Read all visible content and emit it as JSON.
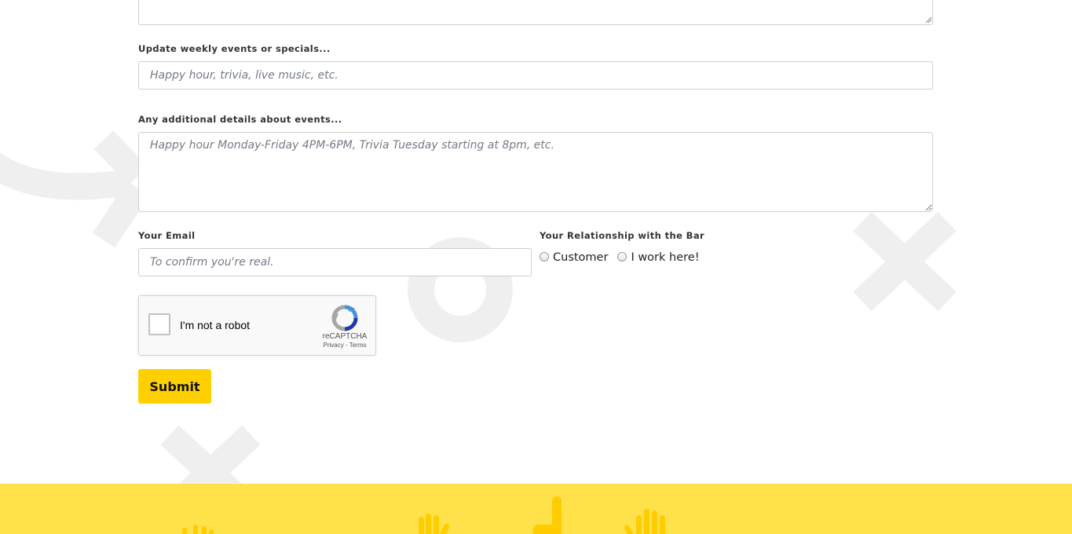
{
  "form": {
    "weekly_events": {
      "label": "Update weekly events or specials...",
      "placeholder": "Happy hour, trivia, live music, etc.",
      "value": ""
    },
    "event_details": {
      "label": "Any additional details about events...",
      "placeholder": "Happy hour Monday-Friday 4PM-6PM, Trivia Tuesday starting at 8pm, etc.",
      "value": ""
    },
    "email": {
      "label": "Your Email",
      "placeholder": "To confirm you're real.",
      "value": ""
    },
    "relationship": {
      "label": "Your Relationship with the Bar",
      "options": [
        "Customer",
        "I work here!"
      ],
      "selected": null
    },
    "submit_label": "Submit"
  },
  "recaptcha": {
    "label": "I'm not a robot",
    "brand": "reCAPTCHA",
    "privacy": "Privacy",
    "separator": " - ",
    "terms": "Terms",
    "checked": false
  },
  "colors": {
    "accent": "#ffd000",
    "footer": "#ffe24a",
    "footer_hands": "#ffcc00",
    "decoration": "#efefef"
  }
}
